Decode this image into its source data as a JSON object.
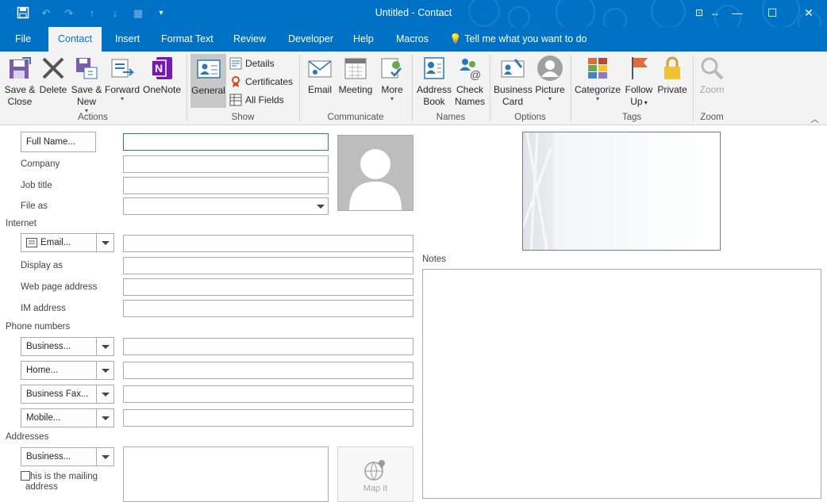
{
  "window": {
    "title": "Untitled  -  Contact",
    "controls": {
      "minimize": "—",
      "maximize": "☐",
      "close": "✕"
    }
  },
  "tabs": [
    {
      "label": "File"
    },
    {
      "label": "Contact"
    },
    {
      "label": "Insert"
    },
    {
      "label": "Format Text"
    },
    {
      "label": "Review"
    },
    {
      "label": "Developer"
    },
    {
      "label": "Help"
    },
    {
      "label": "Macros"
    }
  ],
  "tell_me": "Tell me what you want to do",
  "ribbon": {
    "actions": {
      "save_close_1": "Save &",
      "save_close_2": "Close",
      "delete": "Delete",
      "save_new_1": "Save &",
      "save_new_2": "New",
      "forward": "Forward",
      "onenote": "OneNote",
      "group": "Actions"
    },
    "show": {
      "general": "General",
      "details": "Details",
      "certificates": "Certificates",
      "all_fields": "All Fields",
      "group": "Show"
    },
    "communicate": {
      "email": "Email",
      "meeting": "Meeting",
      "more": "More",
      "group": "Communicate"
    },
    "names": {
      "address_book_1": "Address",
      "address_book_2": "Book",
      "check_names_1": "Check",
      "check_names_2": "Names",
      "group": "Names"
    },
    "options": {
      "business_card_1": "Business",
      "business_card_2": "Card",
      "picture": "Picture",
      "group": "Options"
    },
    "tags": {
      "categorize": "Categorize",
      "follow_up_1": "Follow",
      "follow_up_2": "Up",
      "private": "Private",
      "group": "Tags"
    },
    "zoom": {
      "zoom": "Zoom",
      "group": "Zoom"
    }
  },
  "form": {
    "full_name_button": "Full Name...",
    "company_label": "Company",
    "job_title_label": "Job title",
    "file_as_label": "File as",
    "internet_section": "Internet",
    "email_button": "Email...",
    "display_as_label": "Display as",
    "web_page_label": "Web page address",
    "im_label": "IM address",
    "phone_section": "Phone numbers",
    "phones": [
      "Business...",
      "Home...",
      "Business Fax...",
      "Mobile..."
    ],
    "addresses_section": "Addresses",
    "address_button": "Business...",
    "mailing_check_1": "his is the mailing",
    "mailing_check_2": "address",
    "map_it": "Map It",
    "notes_label": "Notes"
  }
}
